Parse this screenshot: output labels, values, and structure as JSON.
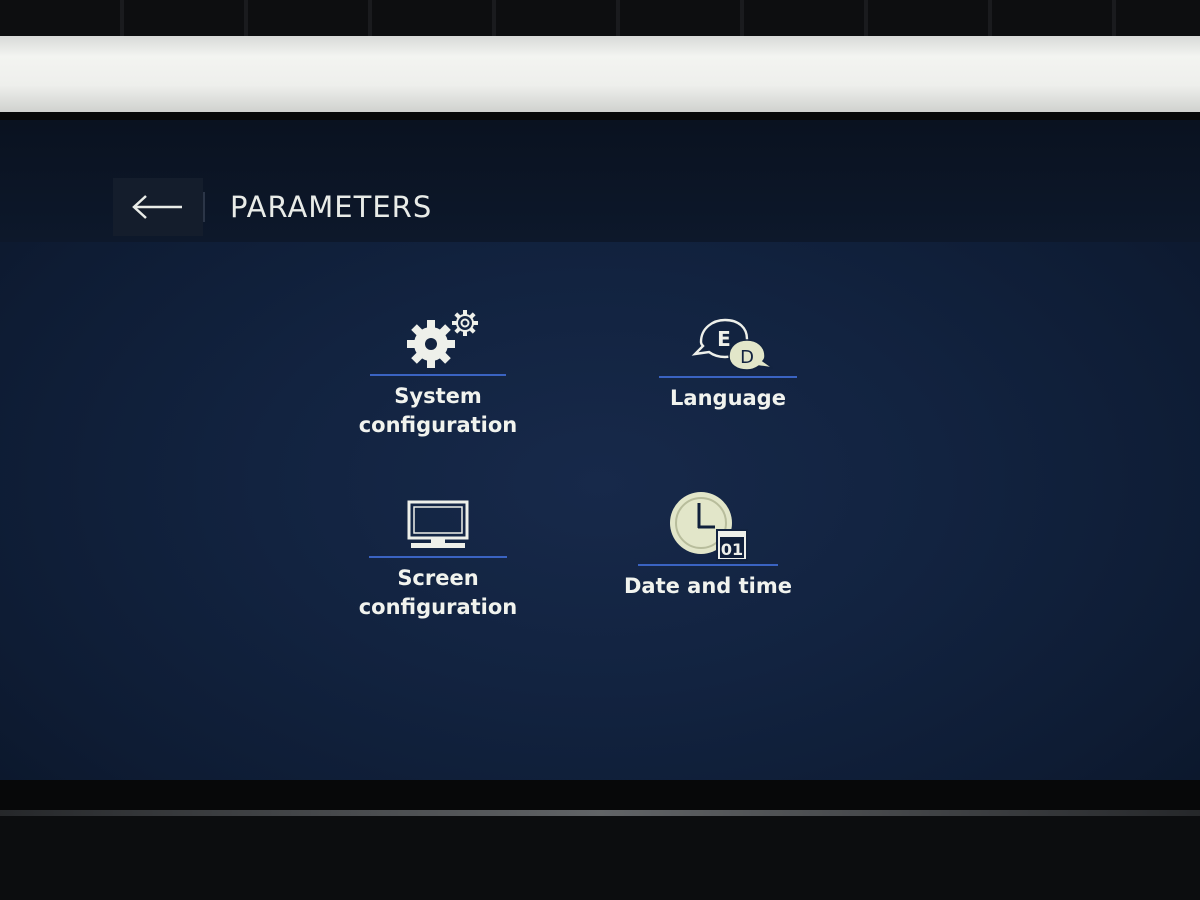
{
  "header": {
    "title": "PARAMETERS",
    "back_icon": "arrow-left-icon"
  },
  "menu": {
    "items": [
      {
        "id": "system",
        "label": "System\nconfiguration",
        "icon": "gears-icon"
      },
      {
        "id": "language",
        "label": "Language",
        "icon": "speech-bubbles-icon",
        "icon_letters": [
          "E",
          "D"
        ]
      },
      {
        "id": "screen",
        "label": "Screen\nconfiguration",
        "icon": "monitor-icon"
      },
      {
        "id": "datetime",
        "label": "Date and time",
        "icon": "clock-calendar-icon",
        "icon_text": "01"
      }
    ]
  },
  "colors": {
    "screen_background": "#122340",
    "accent_underline": "#3a63c2",
    "text": "#f1f3ee"
  }
}
